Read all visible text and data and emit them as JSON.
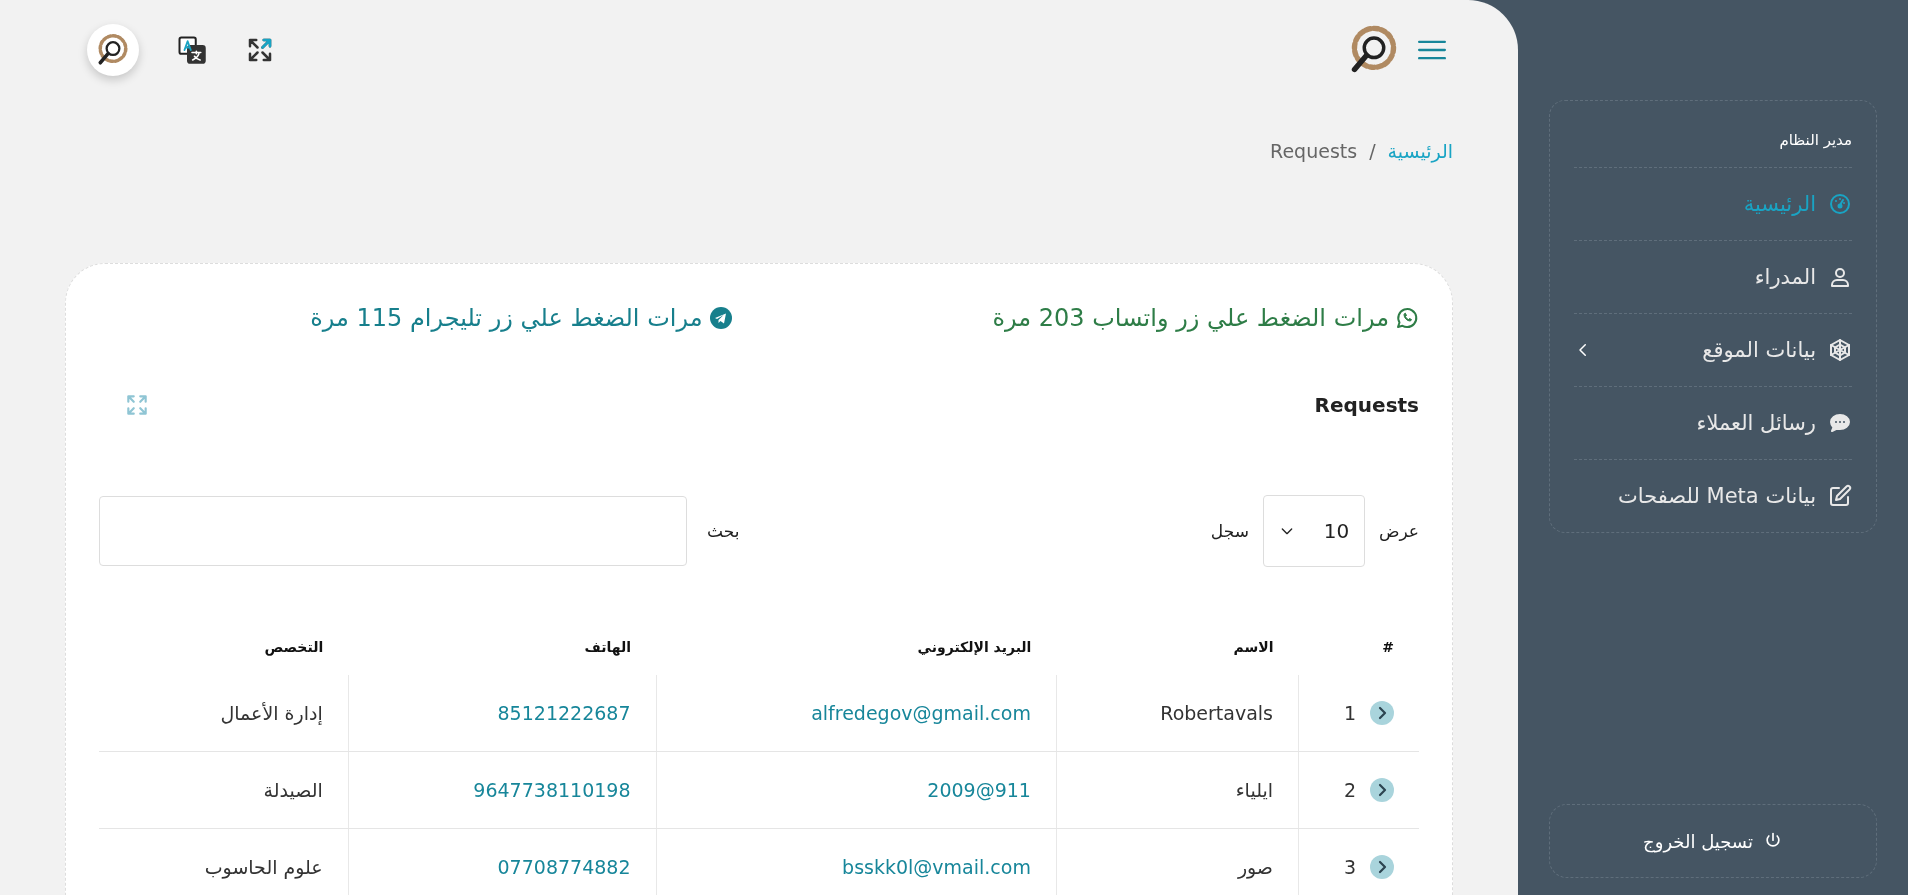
{
  "sidebar": {
    "heading": "مدير النظام",
    "items": [
      {
        "label": "الرئيسية",
        "kind": "gauge",
        "selected": true,
        "has_submenu": false
      },
      {
        "label": "المدراء",
        "kind": "user",
        "selected": false,
        "has_submenu": false
      },
      {
        "label": "بيانات الموقع",
        "kind": "web",
        "selected": false,
        "has_submenu": true
      },
      {
        "label": "رسائل العملاء",
        "kind": "chat",
        "selected": false,
        "has_submenu": false
      },
      {
        "label": "بيانات Meta للصفحات",
        "kind": "edit",
        "selected": false,
        "has_submenu": false
      }
    ],
    "logout": "تسجيل الخروج"
  },
  "breadcrumb": [
    {
      "label": "الرئيسية",
      "kind": "link"
    },
    {
      "label": "/",
      "kind": "separator"
    },
    {
      "label": "Requests",
      "kind": "current"
    }
  ],
  "counters": [
    {
      "kind": "whatsapp",
      "text": "مرات الضغط علي زر واتساب 203 مرة"
    },
    {
      "kind": "telegram",
      "text": "مرات الضغط علي زر تليجرام 115 مرة"
    }
  ],
  "card": {
    "title": "Requests",
    "length_label_before": "عرض",
    "length_value": "10",
    "length_label_after": "سجل",
    "search_label": "بحث"
  },
  "table": {
    "columns": [
      "#",
      "الاسم",
      "البريد الإلكتروني",
      "الهاتف",
      "التخصص"
    ],
    "rows": [
      [
        "1",
        "Robertavals",
        "alfredegov@gmail.com",
        "85121222687",
        "إدارة الأعمال"
      ],
      [
        "2",
        "ايلياء",
        "911@2009",
        "9647738110198",
        "الصيدلة"
      ],
      [
        "3",
        "صور",
        "bsskk0l@vmail.com",
        "07708774882",
        "علوم الحاسوب"
      ]
    ]
  }
}
